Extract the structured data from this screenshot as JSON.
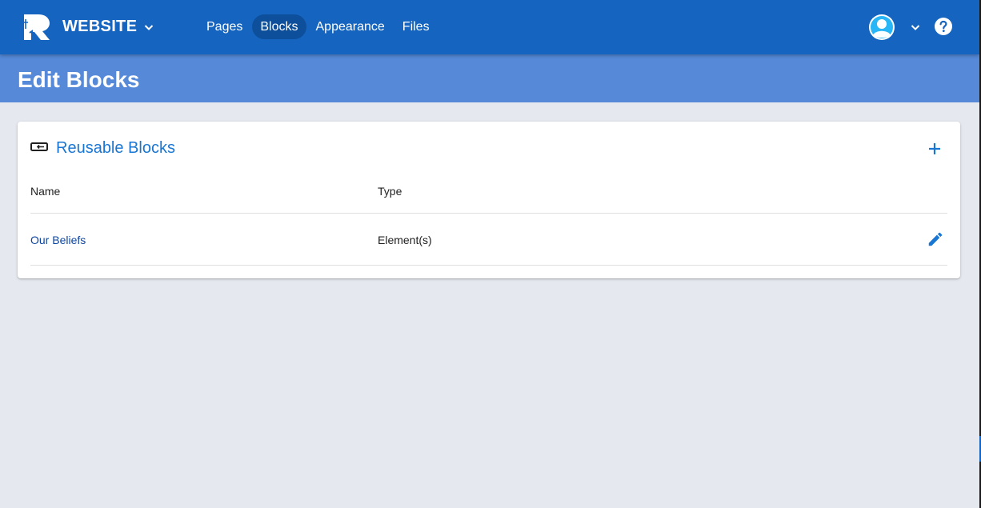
{
  "app": {
    "brand": "WEBSITE",
    "brand_icon": "logo-icon",
    "colors": {
      "primary": "#1565c0",
      "header_band": "#568ad9",
      "accent": "#1976d2",
      "link": "#0d47a1",
      "background": "#e5e8ef"
    }
  },
  "nav": {
    "items": [
      {
        "label": "Pages",
        "active": false
      },
      {
        "label": "Blocks",
        "active": true
      },
      {
        "label": "Appearance",
        "active": false
      },
      {
        "label": "Files",
        "active": false
      }
    ]
  },
  "user_menu": {
    "avatar_icon": "avatar-icon",
    "chevron_icon": "chevron-down-icon",
    "help_icon": "help-icon"
  },
  "page": {
    "title": "Edit Blocks"
  },
  "card": {
    "icon": "block-icon",
    "title": "Reusable Blocks",
    "add_icon": "add-icon",
    "columns": [
      "Name",
      "Type"
    ],
    "rows": [
      {
        "name": "Our Beliefs",
        "type": "Element(s)",
        "action_icon": "edit-icon"
      }
    ]
  }
}
